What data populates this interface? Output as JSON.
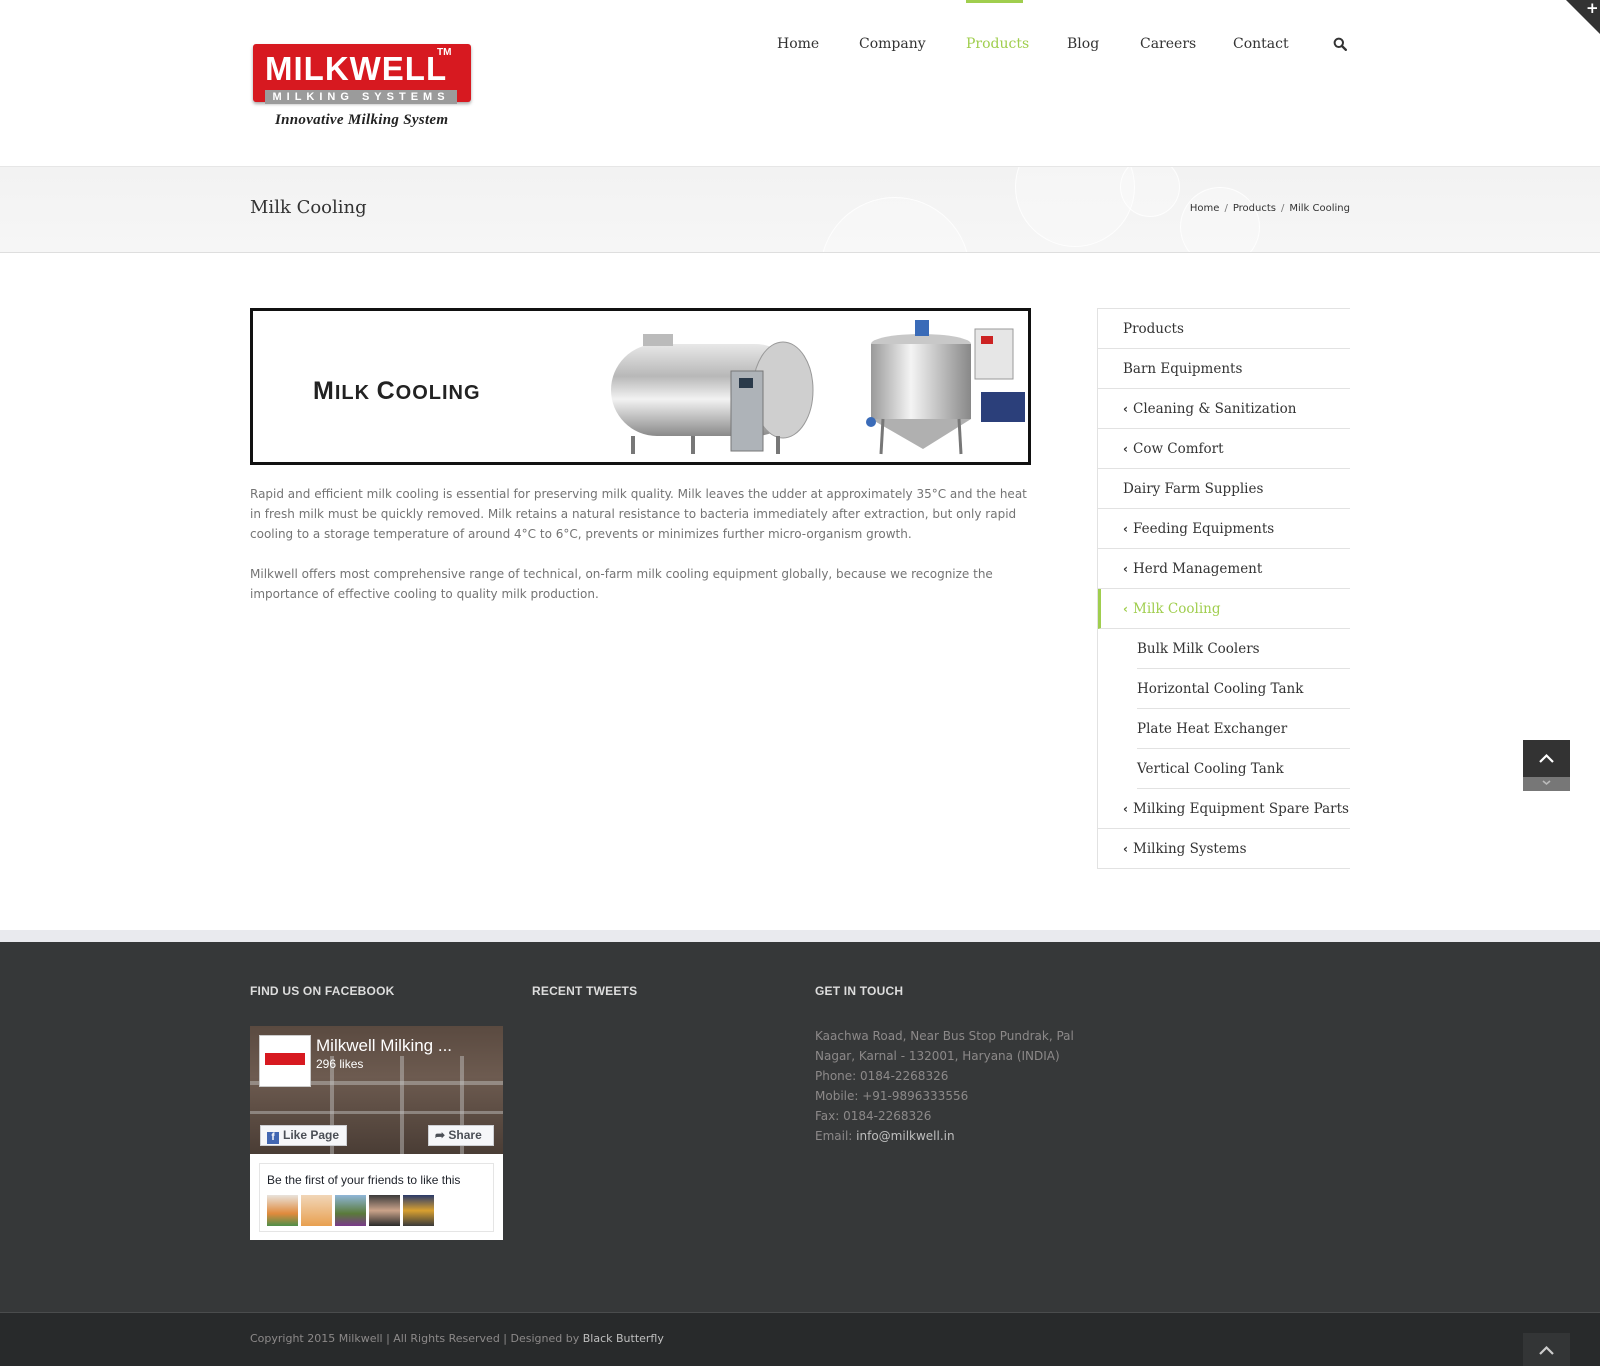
{
  "logo": {
    "brand": "MILKWELL",
    "trademark": "TM",
    "strip": "MILKING SYSTEMS",
    "tagline": "Innovative Milking System"
  },
  "nav": {
    "items": [
      "Home",
      "Company",
      "Products",
      "Blog",
      "Careers",
      "Contact"
    ],
    "active": "Products"
  },
  "page": {
    "title": "Milk Cooling",
    "breadcrumb": [
      "Home",
      "Products",
      "Milk Cooling"
    ]
  },
  "banner": {
    "title": "Milk Cooling"
  },
  "content": {
    "paragraphs": [
      "Rapid and efficient milk cooling is essential for preserving milk quality. Milk leaves the udder at approximately 35°C and the heat in fresh milk must be quickly removed. Milk retains a natural resistance to bacteria immediately after extraction, but only rapid cooling to a storage temperature of around 4°C to 6°C, prevents or minimizes further micro-organism growth.",
      "Milkwell offers most comprehensive range of technical, on-farm milk cooling equipment globally, because we recognize the importance of effective cooling to quality milk production."
    ]
  },
  "sidebar": {
    "items": [
      {
        "label": "Products",
        "chevron": false
      },
      {
        "label": "Barn Equipments",
        "chevron": false
      },
      {
        "label": "Cleaning & Sanitization",
        "chevron": true
      },
      {
        "label": "Cow Comfort",
        "chevron": true
      },
      {
        "label": "Dairy Farm Supplies",
        "chevron": false
      },
      {
        "label": "Feeding Equipments",
        "chevron": true
      },
      {
        "label": "Herd Management",
        "chevron": true
      },
      {
        "label": "Milk Cooling",
        "chevron": true,
        "active": true
      },
      {
        "label": "Milking Equipment Spare Parts",
        "chevron": true
      },
      {
        "label": "Milking Systems",
        "chevron": true
      }
    ],
    "subitems": [
      "Bulk Milk Coolers",
      "Horizontal Cooling Tank",
      "Plate Heat Exchanger",
      "Vertical Cooling Tank"
    ]
  },
  "footer": {
    "facebook_heading": "FIND US ON FACEBOOK",
    "tweets_heading": "RECENT TWEETS",
    "contact_heading": "GET IN TOUCH",
    "facebook": {
      "page_name": "Milkwell Milking ...",
      "likes": "296 likes",
      "like_label": "Like Page",
      "share_label": "Share",
      "friends_text": "Be the first of your friends to like this"
    },
    "contact": {
      "address": "Kaachwa Road, Near Bus Stop Pundrak, Pal Nagar, Karnal - 132001, Haryana (INDIA)",
      "phone": "Phone: 0184-2268326",
      "mobile": "Mobile: +91-9896333556",
      "fax": "Fax: 0184-2268326",
      "email_label": "Email:",
      "email": "info@milkwell.in"
    },
    "copyright": "Copyright 2015 Milkwell | All Rights Reserved | Designed by",
    "credit": "Black Butterfly"
  },
  "colors": {
    "accent": "#a0ce4e",
    "brand_red": "#d71920",
    "footer_bg": "#363839",
    "bottom_bg": "#282a2b"
  },
  "icons": [
    "search-icon",
    "plus-icon",
    "chevron-left-icon",
    "chevron-up-icon",
    "facebook-icon",
    "share-icon"
  ]
}
